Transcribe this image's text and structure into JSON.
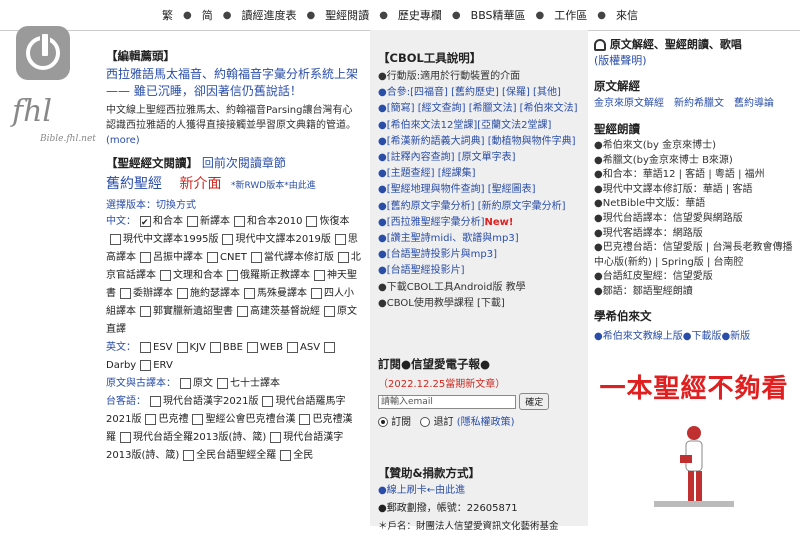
{
  "topnav": [
    "繁",
    "简",
    "讀經進度表",
    "聖經閱讀",
    "歷史專欄",
    "BBS精華區",
    "工作區",
    "來信"
  ],
  "logo": {
    "text": "fhl",
    "sub": "Bible.fhl.net"
  },
  "left": {
    "edit_title": "【編輯薦頭】",
    "headline": "西拉雅語馬太福音、約翰福音字彙分析系統上架—— 雖已沉睡，卻因著信仍舊說話！",
    "intro": "中文線上聖經西拉雅馬太、約翰福音Parsing讓台灣有心認識西拉雅語的人獲得直接接觸並學習原文典籍的管道。",
    "more": "(more)",
    "read_title": "【聖經經文閱讀】",
    "read_link": "回前次閱讀章節",
    "jiu": "舊約聖經",
    "new": "新介面",
    "rwd": "*新RWD版本*由此進",
    "version_label": "選擇版本：",
    "version_toggle": "切換方式",
    "zh_label": "中文：",
    "zh_versions": [
      "和合本",
      "新譯本",
      "和合本2010",
      "恢復本",
      "現代中文譯本1995版",
      "現代中文譯本2019版",
      "思高譯本",
      "呂振中譯本",
      "CNET",
      "當代譯本修訂版",
      "北京官話譯本",
      "文理和合本",
      "俄羅斯正教譯本",
      "神天聖書",
      "委辦譯本",
      "施約瑟譯本",
      "馬殊曼譯本",
      "四人小組譯本",
      "郭實臘新遺詔聖書",
      "高建茨基督說經",
      "原文直譯"
    ],
    "en_label": "英文：",
    "en_versions": [
      "ESV",
      "KJV",
      "BBE",
      "WEB",
      "ASV",
      "Darby",
      "ERV"
    ],
    "orig_label": "原文與古譯本：",
    "orig_versions": [
      "原文",
      "七十士譯本"
    ],
    "tw_label": "台客語：",
    "tw_versions": [
      "現代台語漢字2021版",
      "現代台語羅馬字2021版",
      "巴克禮",
      "聖經公會巴克禮台漢",
      "巴克禮漢羅",
      "現代台語全羅2013版(詩、箴)",
      "現代台語漢字2013版(詩、箴)",
      "全民台語聖經全羅",
      "全民"
    ]
  },
  "mid": {
    "cbol_title": "【CBOL工具說明】",
    "lines": [
      "●行動版:適用於行動裝置的介面",
      "●合參:[四福音] [舊約歷史] [保羅] [其他]",
      "●[簡寫] [經文查詢] [希臘文法] [希伯來文法]",
      "●[希伯來文法12堂課][亞蘭文法2堂課]",
      "●[希漢新約語義大詞典] [動植物與物件字典]",
      "●[註釋內容查詢] [原文單字表]",
      "●[主題查經] [經課集]",
      "●[聖經地理與物件查詢] [聖經圖表]",
      "●[舊約原文字彙分析] [新約原文字彙分析]",
      "●[西拉雅聖經字彙分析]",
      "●[讚主聖詩midi、歌譜與mp3]",
      "●[台語聖詩投影片與mp3]",
      "●[台語聖經投影片]",
      "●下載CBOL工具Android版 教學",
      "●CBOL使用教學課程 [下載]"
    ],
    "new_tag": "New!",
    "sub_title": "訂閱●信望愛電子報●",
    "sub_date": "（2022.12.25當期新文章）",
    "email_placeholder": "請輸入email",
    "confirm": "確定",
    "subscribe": "訂閱",
    "unsubscribe": "退訂",
    "privacy": "(隱私權政策)",
    "donate_title": "【贊助&捐款方式】",
    "donate_online": "●線上刷卡←由此進",
    "postal": "●郵政劃撥，帳號：22605871",
    "account": "＊戶名：財團法人信望愛資訊文化藝術基金"
  },
  "right": {
    "head": "原文解經、聖經朗讀、歌唱",
    "head_link": "(版權聲明)",
    "sec1": "原文解經",
    "sec1_links": "金京來原文解經　新約希臘文　舊約導論",
    "sec2": "聖經朗讀",
    "sec2_lines": [
      "●希伯來文(by 金京來博士)",
      "●希臘文(by金京來博士 B來源)",
      "●和合本：華語12 | 客語 | 粵語 | 福州",
      "●現代中文譯本修訂版：華語 | 客語",
      "●NetBible中文版：華語",
      "●現代台語譯本：信望愛與網路版",
      "●現代客語譯本：網路版",
      "●巴克禮台語：信望愛版 | 台灣長老教會傳播中心版(新約) | Spring版 | 台南腔",
      "●台語紅皮聖經：信望愛版",
      "●鄒語：鄒語聖經朗讀"
    ],
    "sec3": "學希伯來文",
    "sec3_line": "●希伯來文教線上版●下載版●新版",
    "banner": "一本聖經不夠看"
  }
}
